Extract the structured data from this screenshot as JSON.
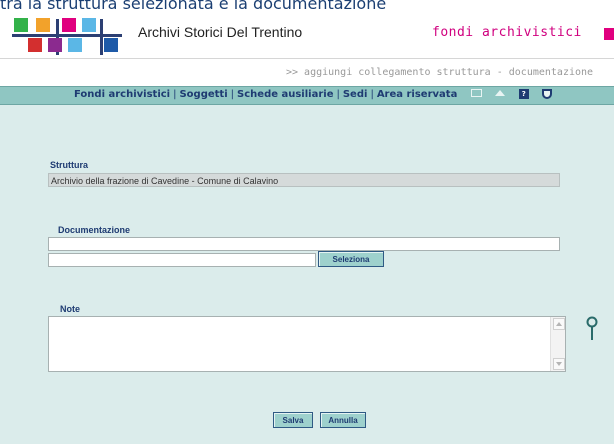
{
  "page_caption": "tra la struttura selezionata e la documentazione",
  "header": {
    "site_title": "Archivi Storici Del Trentino",
    "section_title": "fondi archivistici",
    "breadcrumb": ">> aggiungi collegamento struttura - documentazione"
  },
  "nav": {
    "items": [
      "Fondi archivistici",
      "Soggetti",
      "Schede ausiliarie",
      "Sedi",
      "Area riservata"
    ],
    "separator": "|",
    "icons": [
      "mail-icon",
      "home-icon",
      "help-icon",
      "shield-icon"
    ]
  },
  "form": {
    "struttura_label": "Struttura",
    "struttura_value": "Archivio della frazione di Cavedine - Comune di Calavino",
    "documentazione_label": "Documentazione",
    "documentazione_value": "",
    "documentazione_code": "",
    "seleziona_label": "Seleziona",
    "note_label": "Note",
    "note_value": "",
    "salva_label": "Salva",
    "annulla_label": "Annulla"
  },
  "colors": {
    "navbar": "#8fc6c2",
    "content_bg": "#dbeceb",
    "nav_text": "#1e3b72",
    "section_accent": "#d0007f"
  }
}
